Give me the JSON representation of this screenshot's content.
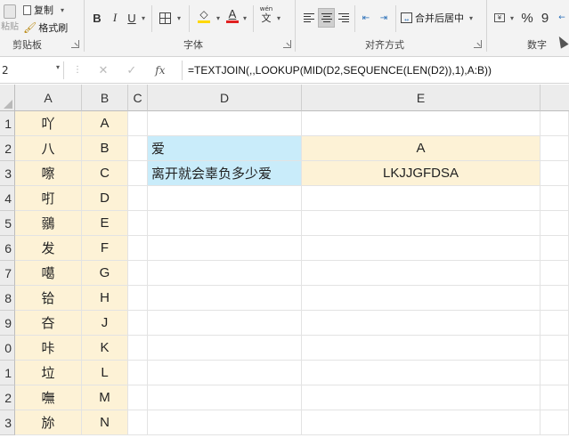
{
  "ribbon": {
    "paste_label": "粘贴",
    "copy_label": "复制",
    "format_painter_label": "格式刷",
    "clipboard_group": "剪贴板",
    "font_group": "字体",
    "align_group": "对齐方式",
    "number_group": "数字",
    "bold": "B",
    "italic": "I",
    "underline": "U",
    "font_color_letter": "A",
    "wen_label": "wén",
    "wen_char": "文",
    "merge_center_label": "合并后居中",
    "percent": "%",
    "comma": "9",
    "font_color": "#e02020",
    "fill_color": "#ffd800"
  },
  "formula_bar": {
    "name_box": "2",
    "formula": "=TEXTJOIN(,,LOOKUP(MID(D2,SEQUENCE(LEN(D2)),1),A:B))",
    "fx_label": "fx",
    "cancel_symbol": "✕",
    "enter_symbol": "✓"
  },
  "columns": [
    "A",
    "B",
    "C",
    "D",
    "E"
  ],
  "rows": [
    {
      "num": "1",
      "a": "吖",
      "b": "A",
      "d": "",
      "e": ""
    },
    {
      "num": "2",
      "a": "八",
      "b": "B",
      "d": "爱",
      "e": "A"
    },
    {
      "num": "3",
      "a": "嚓",
      "b": "C",
      "d": "离开就会辜负多少爱",
      "e": "LKJJGFDSA"
    },
    {
      "num": "4",
      "a": "咑",
      "b": "D",
      "d": "",
      "e": ""
    },
    {
      "num": "5",
      "a": "鶸",
      "b": "E",
      "d": "",
      "e": ""
    },
    {
      "num": "6",
      "a": "发",
      "b": "F",
      "d": "",
      "e": ""
    },
    {
      "num": "7",
      "a": "噶",
      "b": "G",
      "d": "",
      "e": ""
    },
    {
      "num": "8",
      "a": "铪",
      "b": "H",
      "d": "",
      "e": ""
    },
    {
      "num": "9",
      "a": "夻",
      "b": "J",
      "d": "",
      "e": ""
    },
    {
      "num": "0",
      "a": "咔",
      "b": "K",
      "d": "",
      "e": ""
    },
    {
      "num": "1",
      "a": "垃",
      "b": "L",
      "d": "",
      "e": ""
    },
    {
      "num": "2",
      "a": "嘸",
      "b": "M",
      "d": "",
      "e": ""
    },
    {
      "num": "3",
      "a": "旀",
      "b": "N",
      "d": "",
      "e": ""
    }
  ]
}
